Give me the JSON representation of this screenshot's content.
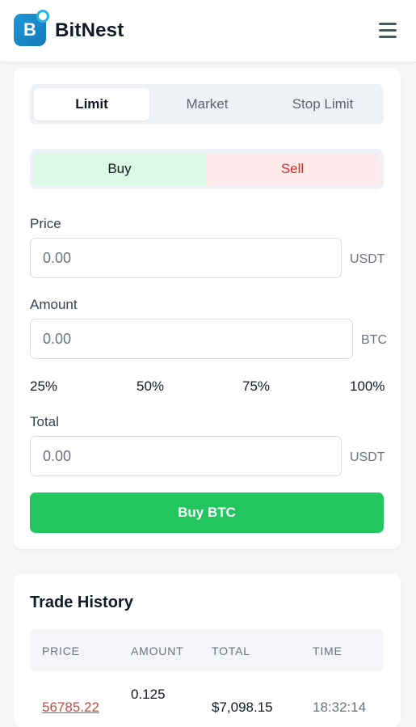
{
  "header": {
    "logo_letter": "B",
    "brand": "BitNest"
  },
  "order_types": [
    "Limit",
    "Market",
    "Stop Limit"
  ],
  "active_order_type": "Limit",
  "side": {
    "buy_label": "Buy",
    "sell_label": "Sell",
    "active": "Buy"
  },
  "form": {
    "price_label": "Price",
    "price_value": "0.00",
    "price_unit": "USDT",
    "amount_label": "Amount",
    "amount_value": "0.00",
    "amount_unit": "BTC",
    "percentages": [
      "25%",
      "50%",
      "75%",
      "100%"
    ],
    "total_label": "Total",
    "total_value": "0.00",
    "total_unit": "USDT",
    "submit_label": "Buy BTC"
  },
  "history": {
    "title": "Trade History",
    "columns": [
      "PRICE",
      "AMOUNT",
      "TOTAL",
      "TIME"
    ],
    "rows": [
      {
        "price": "56785.22",
        "amount": "0.125",
        "total": "$7,098.15",
        "time": "18:32:14"
      }
    ]
  },
  "colors": {
    "accent_green": "#22c55e",
    "sell_red": "#d32f2f",
    "brand_blue": "#1476b8"
  }
}
